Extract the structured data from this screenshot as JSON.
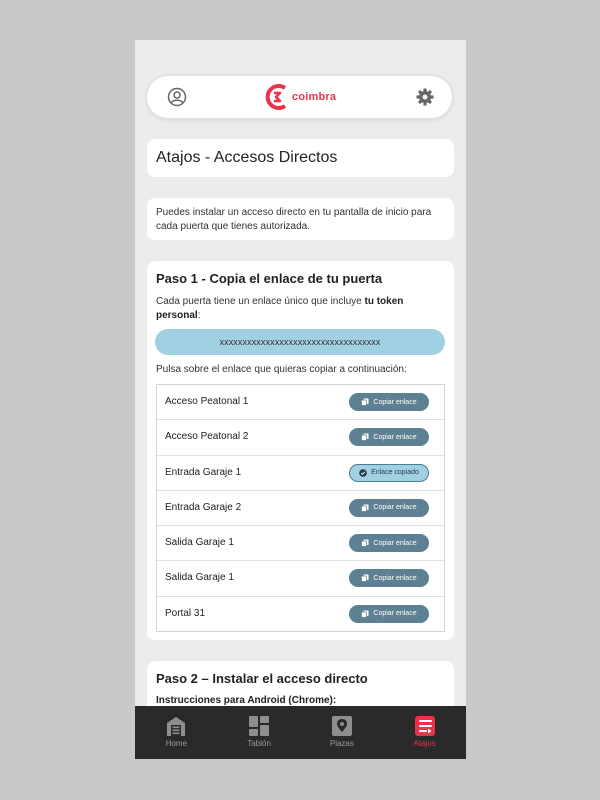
{
  "app": {
    "brand": "coimbra",
    "brand_color": "#e8334a",
    "accent": "#5d8193",
    "token_bg": "#a2d0e3"
  },
  "header": {
    "user_icon": "user-circle-icon",
    "settings_icon": "gear-icon"
  },
  "title": "Atajos - Accesos Directos",
  "intro": "Puedes instalar un acceso directo en tu pantalla de inicio para cada puerta que tienes autorizada.",
  "step1": {
    "title": "Paso 1 - Copia el enlace de tu puerta",
    "desc_prefix": "Cada puerta tiene un enlace único que incluye ",
    "desc_bold": "tu token personal",
    "desc_suffix": ":",
    "token": "xxxxxxxxxxxxxxxxxxxxxxxxxxxxxxxxxxx",
    "copy_instruction": "Pulsa sobre el enlace que quieras copiar a continuación:",
    "doors": [
      {
        "name": "Acceso Peatonal 1",
        "button": "Copiar enlace",
        "copied": false
      },
      {
        "name": "Acceso Peatonal 2",
        "button": "Copiar enlace",
        "copied": false
      },
      {
        "name": "Entrada Garaje 1",
        "button": "Enlace copiado",
        "copied": true
      },
      {
        "name": "Entrada Garaje 2",
        "button": "Copiar enlace",
        "copied": false
      },
      {
        "name": "Salida Garaje 1",
        "button": "Copiar enlace",
        "copied": false
      },
      {
        "name": "Salida Garaje 1",
        "button": "Copiar enlace",
        "copied": false
      },
      {
        "name": "Portal 31",
        "button": "Copiar enlace",
        "copied": false
      }
    ]
  },
  "step2": {
    "title": "Paso 2 – Instalar el acceso directo",
    "subtitle": "Instrucciones para Android (Chrome):"
  },
  "nav": [
    {
      "label": "Home",
      "icon": "garage-icon",
      "active": false
    },
    {
      "label": "Tablón",
      "icon": "dashboard-icon",
      "active": false
    },
    {
      "label": "Plazas",
      "icon": "map-pin-icon",
      "active": false
    },
    {
      "label": "Atajos",
      "icon": "shortcut-icon",
      "active": true
    }
  ]
}
